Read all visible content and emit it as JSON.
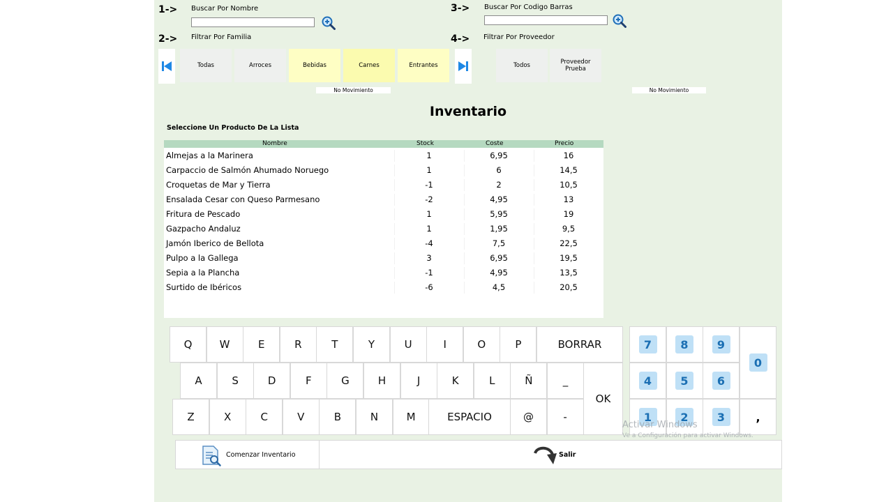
{
  "search": {
    "step1": "1->",
    "name_label": "Buscar Por Nombre",
    "name_value": "",
    "step2": "2->",
    "family_label": "Filtrar Por Familia",
    "step3": "3->",
    "barcode_label": "Buscar Por Codigo Barras",
    "barcode_value": "",
    "step4": "4->",
    "supplier_label": "Filtrar Por Proveedor"
  },
  "families": [
    "Todas",
    "Arroces",
    "Bebidas",
    "Carnes",
    "Entrantes"
  ],
  "suppliers": [
    "Todos",
    "Proveedor Prueba"
  ],
  "no_movement_left": "No Movimiento",
  "no_movement_right": "No Movimiento",
  "page_title": "Inventario",
  "subtitle": "Seleccione Un Producto De La Lista",
  "table": {
    "headers": [
      "Nombre",
      "Stock",
      "Coste",
      "Precio"
    ],
    "rows": [
      [
        "Almejas a la Marinera",
        "1",
        "6,95",
        "16"
      ],
      [
        "Carpaccio de Salmón Ahumado Noruego",
        "1",
        "6",
        "14,5"
      ],
      [
        "Croquetas de Mar y Tierra",
        "-1",
        "2",
        "10,5"
      ],
      [
        "Ensalada Cesar con Queso Parmesano",
        "-2",
        "4,95",
        "13"
      ],
      [
        "Fritura de Pescado",
        "1",
        "5,95",
        "19"
      ],
      [
        "Gazpacho Andaluz",
        "1",
        "1,95",
        "9,5"
      ],
      [
        "Jamón Iberico de Bellota",
        "-4",
        "7,5",
        "22,5"
      ],
      [
        "Pulpo a la Gallega",
        "3",
        "6,95",
        "19,5"
      ],
      [
        "Sepia a la Plancha",
        "-1",
        "4,95",
        "13,5"
      ],
      [
        "Surtido de Ibéricos",
        "-6",
        "4,5",
        "20,5"
      ]
    ]
  },
  "keyboard": {
    "row1": [
      "Q",
      "W",
      "E",
      "R",
      "T",
      "Y",
      "U",
      "I",
      "O",
      "P"
    ],
    "borrar": "BORRAR",
    "row2": [
      "A",
      "S",
      "D",
      "F",
      "G",
      "H",
      "J",
      "K",
      "L",
      "Ñ",
      "_"
    ],
    "ok": "OK",
    "row3": [
      "Z",
      "X",
      "C",
      "V",
      "B",
      "N",
      "M"
    ],
    "espacio": "ESPACIO",
    "row3b": [
      "@",
      "-"
    ]
  },
  "numpad": {
    "row1": [
      "7",
      "8",
      "9"
    ],
    "zero": "0",
    "row2": [
      "4",
      "5",
      "6"
    ],
    "row3": [
      "1",
      "2",
      "3"
    ],
    "comma": ","
  },
  "actions": {
    "start": "Comenzar Inventario",
    "exit": "Salir"
  },
  "watermark": {
    "line1": "Activar Windows",
    "line2": "Ve a Configuración para activar Windows."
  },
  "colors": {
    "app_bg": "#e9f2e4",
    "table_header": "#b5d9c0",
    "family_yellow": "#fefec4",
    "nav_blue": "#1e88e5"
  }
}
